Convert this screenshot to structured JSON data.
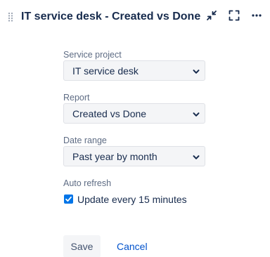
{
  "header": {
    "title": "IT service desk - Created vs Done",
    "icons": [
      "drag-handle-icon",
      "minimize-icon",
      "fullscreen-icon",
      "more-icon"
    ]
  },
  "form": {
    "service_project": {
      "label": "Service project",
      "value": "IT service desk"
    },
    "report": {
      "label": "Report",
      "value": "Created vs Done"
    },
    "date_range": {
      "label": "Date range",
      "value": "Past year by month"
    },
    "auto_refresh": {
      "label": "Auto refresh",
      "checkbox_label": "Update every 15 minutes",
      "checked": true
    }
  },
  "actions": {
    "save_label": "Save",
    "cancel_label": "Cancel"
  },
  "colors": {
    "checkbox": "#0075e8",
    "link": "#0052cc",
    "field_bg": "#f4f5f7",
    "text": "#172b4d",
    "label": "#5e6c84"
  }
}
